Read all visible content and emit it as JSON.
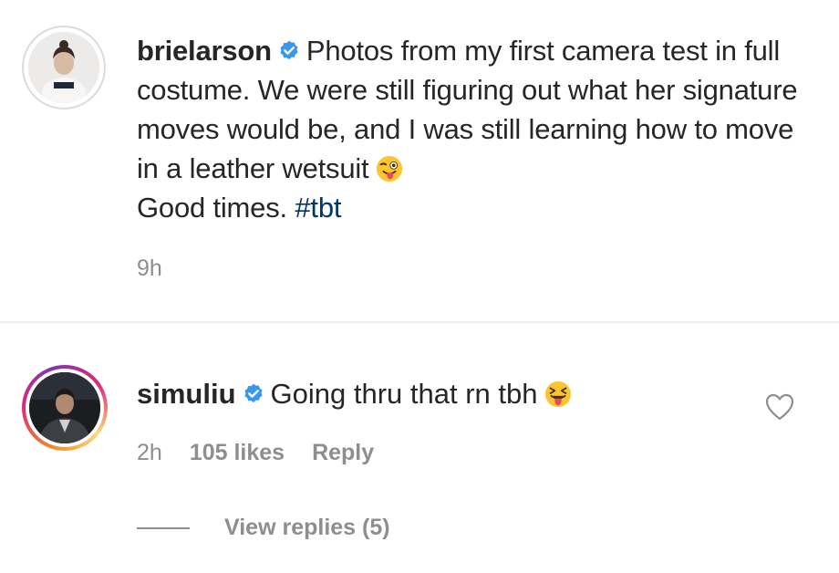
{
  "caption": {
    "username": "brielarson",
    "verified": true,
    "text": "Photos from my first camera test in full costume. We were still figuring out what her signature moves would be, and I was still learning how to move in a leather wetsuit",
    "emoji": "winking-face-with-tongue",
    "text_after_emoji": "Good times.",
    "hashtag": "#tbt",
    "time": "9h"
  },
  "comment": {
    "username": "simuliu",
    "verified": true,
    "text": "Going thru that rn tbh",
    "emoji": "squinting-face-with-tongue",
    "time": "2h",
    "likes": "105 likes",
    "reply_label": "Reply",
    "view_replies_label": "View replies (5)"
  },
  "colors": {
    "verified_blue": "#3897f0",
    "hashtag": "#00376b",
    "meta_gray": "#8e8e8e",
    "text": "#262626"
  }
}
